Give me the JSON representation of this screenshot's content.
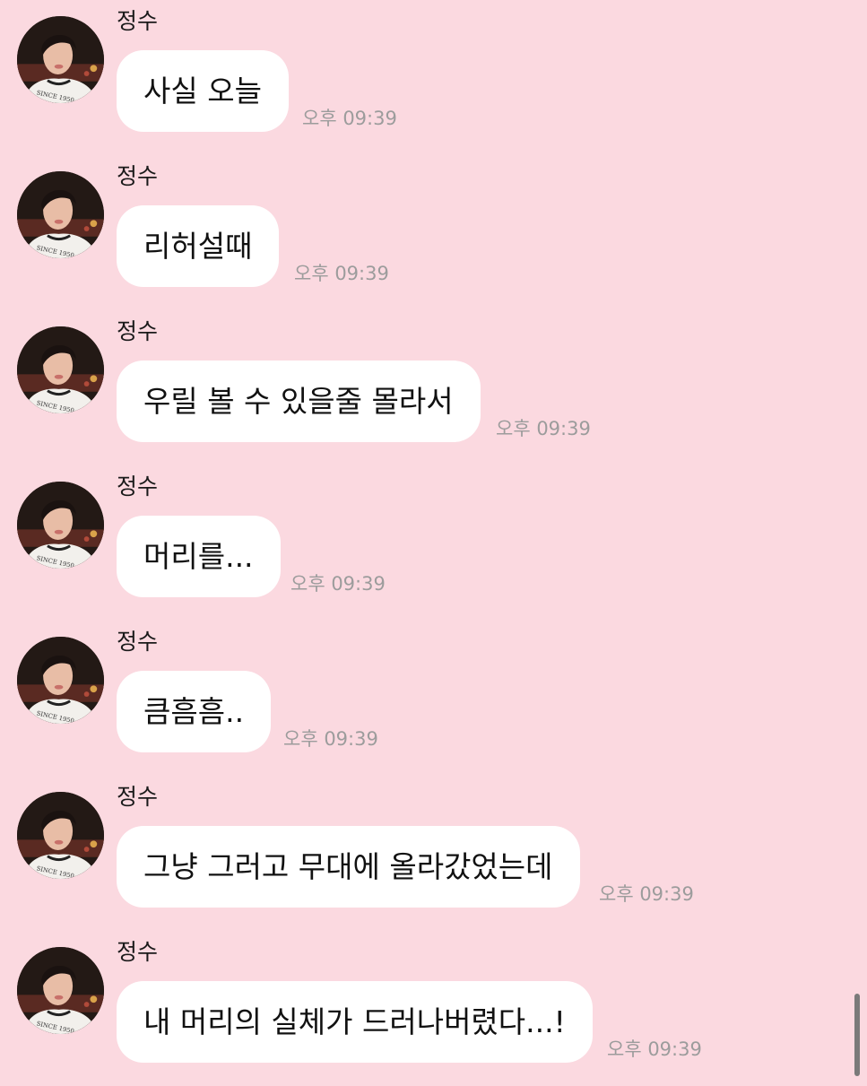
{
  "chat": {
    "messages": [
      {
        "sender": "정수",
        "text": "사실 오늘",
        "time": "오후 09:39"
      },
      {
        "sender": "정수",
        "text": "리허설때",
        "time": "오후 09:39"
      },
      {
        "sender": "정수",
        "text": "우릴 볼 수 있을줄 몰라서",
        "time": "오후 09:39"
      },
      {
        "sender": "정수",
        "text": "머리를...",
        "time": "오후 09:39"
      },
      {
        "sender": "정수",
        "text": "큼흠흠..",
        "time": "오후 09:39"
      },
      {
        "sender": "정수",
        "text": "그냥 그러고 무대에 올라갔었는데",
        "time": "오후 09:39"
      },
      {
        "sender": "정수",
        "text": "내 머리의 실체가 드러나버렸다...!",
        "time": "오후 09:39"
      }
    ],
    "avatar_shirt_text": "SINCE 1950",
    "colors": {
      "background": "#fbd9e0",
      "bubble": "#ffffff",
      "timestamp": "#9c9c9c"
    }
  }
}
